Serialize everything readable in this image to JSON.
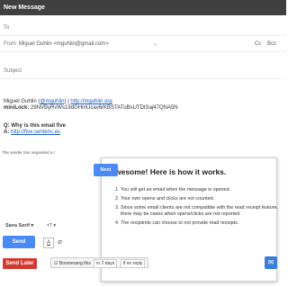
{
  "window": {
    "title": "New Message"
  },
  "to": {
    "label": "To"
  },
  "from": {
    "label": "From",
    "value": "Miguel Guhlin <mguhlin@gmail.com>",
    "cc": "Cc",
    "bcc": "Bcc"
  },
  "subject": {
    "placeholder": "Subject"
  },
  "signature": {
    "name": "Miguel Guhlin (",
    "handle": "@mguhlin",
    "sep": ") | ",
    "url": "http://mguhlin.org",
    "minilock_label": "miniLock:",
    "minilock_value": "29NVByRvWs19dGHmUcav6rKBSTATuBsUTDtSaj47QNA5N"
  },
  "quote": {
    "q": "Q: Why is this email five",
    "a_label": "A:",
    "a_link": "http://five.sentenc.es"
  },
  "receipt_note": "The sender has requested a r",
  "popup": {
    "title": "Awesome! Here is how it works.",
    "items": [
      "You will get an email when the message is opened.",
      "Your own opens and clicks are not counted.",
      "Since some email clients are not compatible with the read receipt feature, there may be cases when opens/clicks are not reported.",
      "The recipients can choose to not provide read receipts."
    ],
    "next": "Next"
  },
  "format_bar": {
    "font": "Sans Serif",
    "size": "тT"
  },
  "bottom": {
    "send": "Send",
    "send_later": "Send Later",
    "boomerang": "Boomerang this",
    "boomerang_when": "in 2 days",
    "boomerang_condition": "if no reply"
  }
}
